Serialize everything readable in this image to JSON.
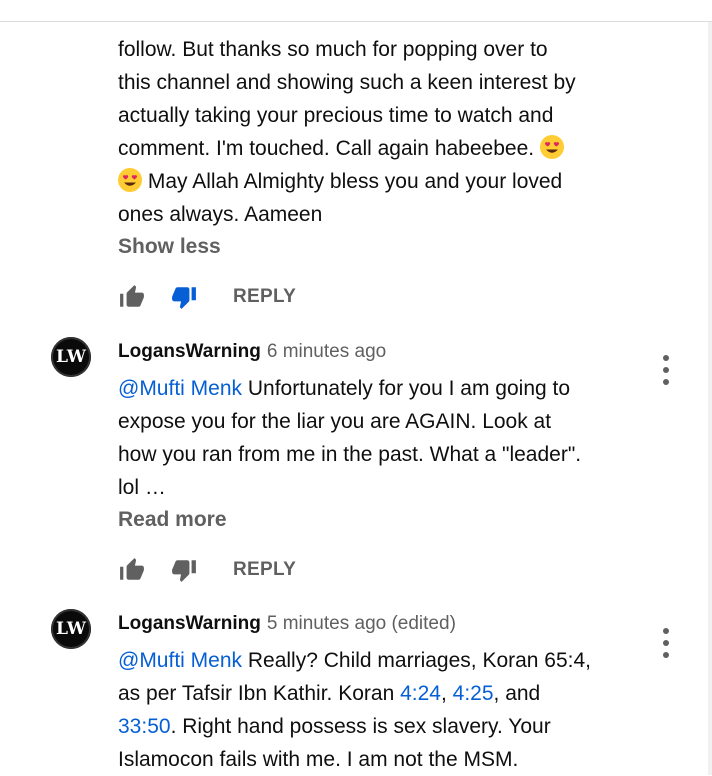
{
  "comment1": {
    "line_top": "follow. But thanks so much for popping over to",
    "line2": "this channel and showing such a keen interest by",
    "line3": "actually taking your precious time to watch and",
    "line4": "comment. I'm touched. Call again habeebee.",
    "line5": "May Allah Almighty bless you and your loved",
    "line6": "ones always. Aameen",
    "toggle": "Show less",
    "reply": "REPLY",
    "disliked": true
  },
  "comment2": {
    "avatar_text": "LW",
    "author": "LogansWarning",
    "time": "6 minutes ago",
    "mention": "@Mufti Menk",
    "line1_rest": " Unfortunately for you I am going to",
    "line2": "expose you for the liar you are AGAIN. Look at",
    "line3": "how you ran from me in the past. What a \"leader\".",
    "line4": "lol …",
    "toggle": "Read more",
    "reply": "REPLY"
  },
  "comment3": {
    "avatar_text": "LW",
    "author": "LogansWarning",
    "time": "5 minutes ago (edited)",
    "mention": "@Mufti Menk",
    "line1_rest": " Really? Child marriages, Koran 65:4,",
    "line2_a": "as per Tafsir Ibn Kathir. Koran ",
    "ref1": "4:24",
    "comma": ", ",
    "ref2": "4:25",
    "line2_b": ", and",
    "ref3": "33:50",
    "line3_rest": ". Right hand possess is sex slavery. Your",
    "line4": "Islamocon fails with me. I am not the MSM."
  },
  "colors": {
    "link": "#065fd4",
    "secondary_text": "#606060",
    "dislike_active": "#065fd4"
  },
  "icons": [
    "thumbs-up-icon",
    "thumbs-down-icon",
    "more-vert-icon",
    "heart-eyes-emoji"
  ]
}
